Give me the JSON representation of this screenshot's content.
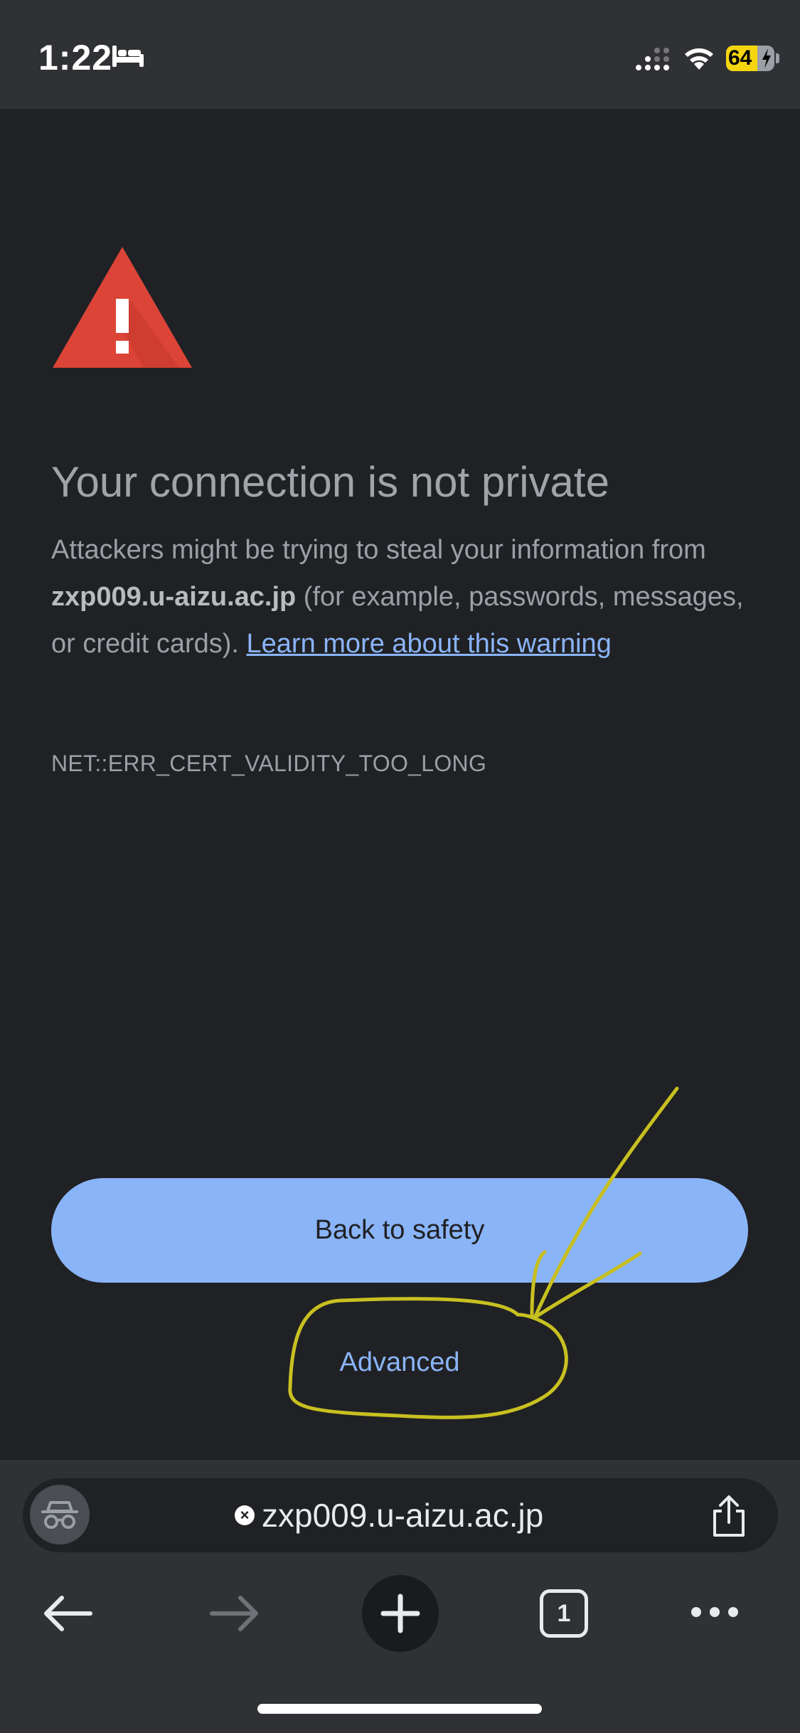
{
  "status_bar": {
    "time": "1:22",
    "battery_level": "64",
    "icons": [
      "bed-icon",
      "cellular-signal-icon",
      "wifi-icon",
      "battery-charging-icon"
    ],
    "battery_color": "#f5d60e"
  },
  "interstitial": {
    "heading": "Your connection is not private",
    "body_before": "Attackers might be trying to steal your information from ",
    "host": "zxp009.u-aizu.ac.jp",
    "body_after": " (for example, passwords, messages, or credit cards). ",
    "learn_more": "Learn more about this warning",
    "error_code": "NET::ERR_CERT_VALIDITY_TOO_LONG",
    "back_button": "Back to safety",
    "advanced": "Advanced"
  },
  "toolbar": {
    "url": "zxp009.u-aizu.ac.jp",
    "tab_count": "1",
    "icons": [
      "incognito-icon",
      "url-security-x-icon",
      "share-icon",
      "back-arrow-icon",
      "forward-arrow-icon",
      "plus-icon",
      "tab-switcher-icon",
      "more-dots-icon"
    ]
  },
  "colors": {
    "page_bg": "#202124",
    "bar_bg": "#303134",
    "accent": "#8ab4f8",
    "warning_red": "#db4437",
    "annotation_yellow": "#c8c020"
  }
}
